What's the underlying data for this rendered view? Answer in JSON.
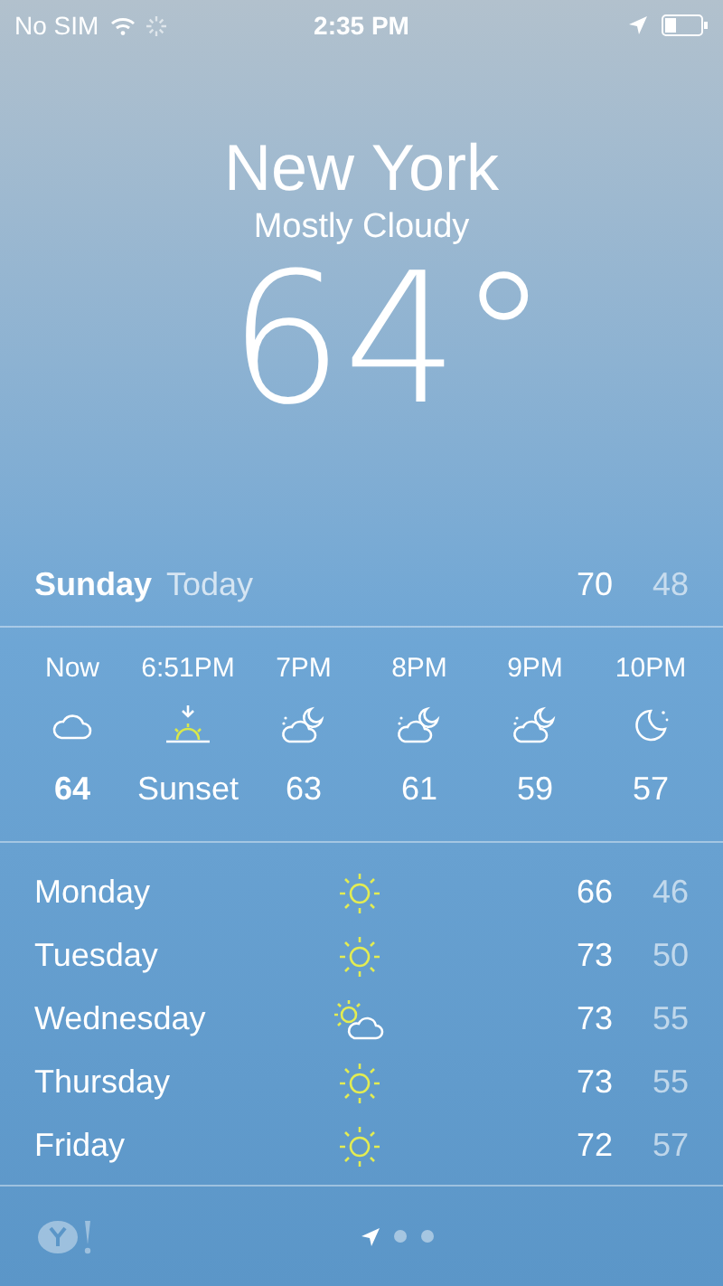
{
  "status_bar": {
    "carrier": "No SIM",
    "time": "2:35 PM"
  },
  "location": {
    "city": "New York",
    "condition": "Mostly Cloudy",
    "temperature": "64°"
  },
  "today": {
    "day": "Sunday",
    "label": "Today",
    "high": "70",
    "low": "48"
  },
  "hourly": [
    {
      "time": "Now",
      "kind": "cloud",
      "value": "64",
      "bold": true
    },
    {
      "time": "6:51PM",
      "kind": "sunset",
      "value": "Sunset",
      "bold": false
    },
    {
      "time": "7PM",
      "kind": "cloudmoon",
      "value": "63",
      "bold": false
    },
    {
      "time": "8PM",
      "kind": "cloudmoon",
      "value": "61",
      "bold": false
    },
    {
      "time": "9PM",
      "kind": "cloudmoon",
      "value": "59",
      "bold": false
    },
    {
      "time": "10PM",
      "kind": "moon",
      "value": "57",
      "bold": false
    }
  ],
  "daily": [
    {
      "day": "Monday",
      "kind": "sun",
      "high": "66",
      "low": "46"
    },
    {
      "day": "Tuesday",
      "kind": "sun",
      "high": "73",
      "low": "50"
    },
    {
      "day": "Wednesday",
      "kind": "suncloud",
      "high": "73",
      "low": "55"
    },
    {
      "day": "Thursday",
      "kind": "sun",
      "high": "73",
      "low": "55"
    },
    {
      "day": "Friday",
      "kind": "sun",
      "high": "72",
      "low": "57"
    }
  ],
  "pages": [
    {
      "kind": "location",
      "selected": true
    },
    {
      "kind": "dot",
      "selected": false
    },
    {
      "kind": "dot",
      "selected": false
    }
  ]
}
